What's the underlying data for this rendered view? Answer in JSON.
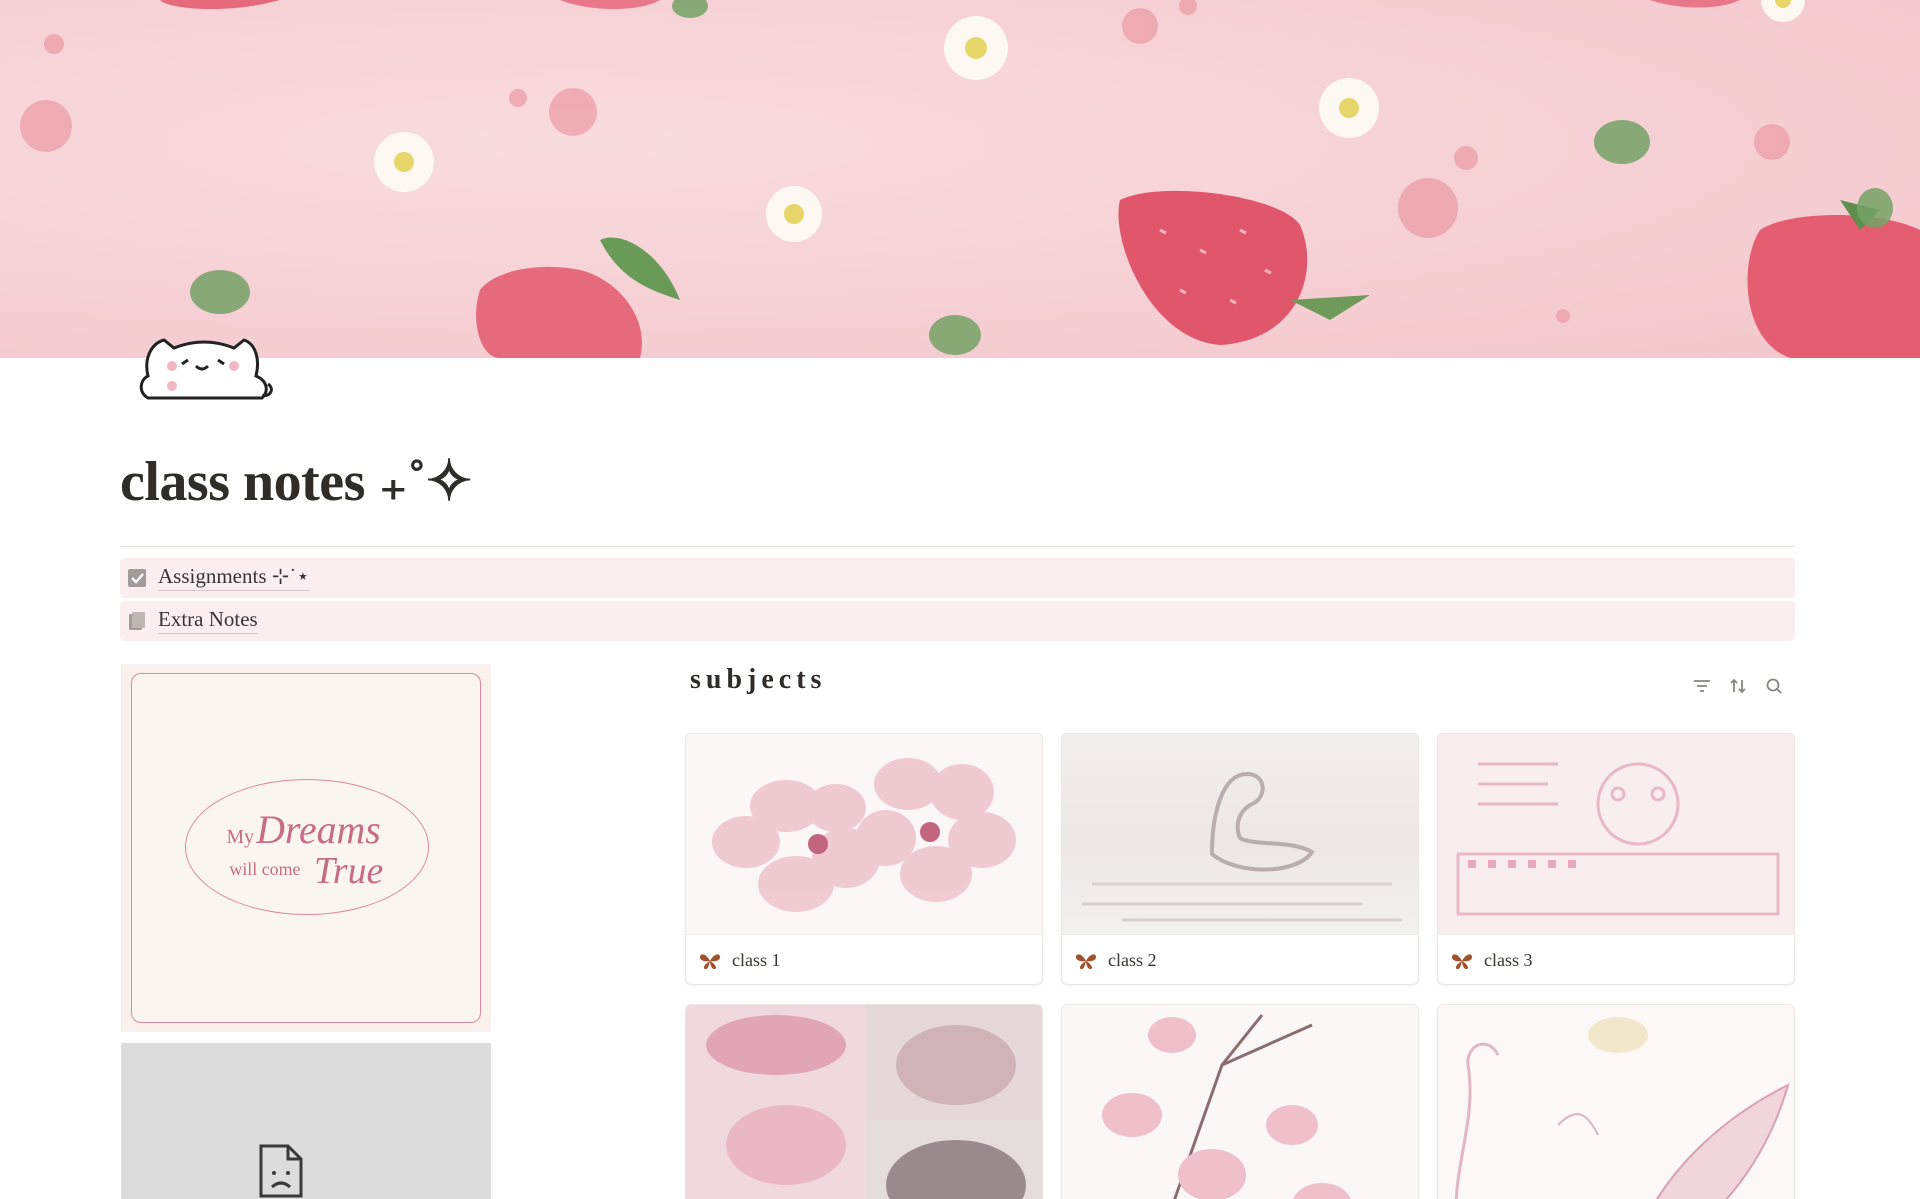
{
  "page": {
    "title": "class notes ₊˚✧",
    "links": [
      {
        "label": "Assignments ⊹˙⋆",
        "icon": "checkbox-icon"
      },
      {
        "label": "Extra Notes",
        "icon": "document-icon"
      }
    ]
  },
  "left": {
    "poster_text": {
      "my": "My",
      "dreams": "Dreams",
      "will_come": "will come",
      "true": "True"
    }
  },
  "database": {
    "title": "subjects",
    "tools": [
      "filter-icon",
      "sort-icon",
      "search-icon"
    ],
    "cards": [
      {
        "name": "class 1",
        "icon": "butterfly-icon"
      },
      {
        "name": "class 2",
        "icon": "butterfly-icon"
      },
      {
        "name": "class 3",
        "icon": "butterfly-icon"
      }
    ]
  },
  "colors": {
    "cover": "#f5cfd3",
    "link_bg": "#fbeef1",
    "accent_pink": "#d98a9e",
    "butterfly": "#a0522d"
  }
}
